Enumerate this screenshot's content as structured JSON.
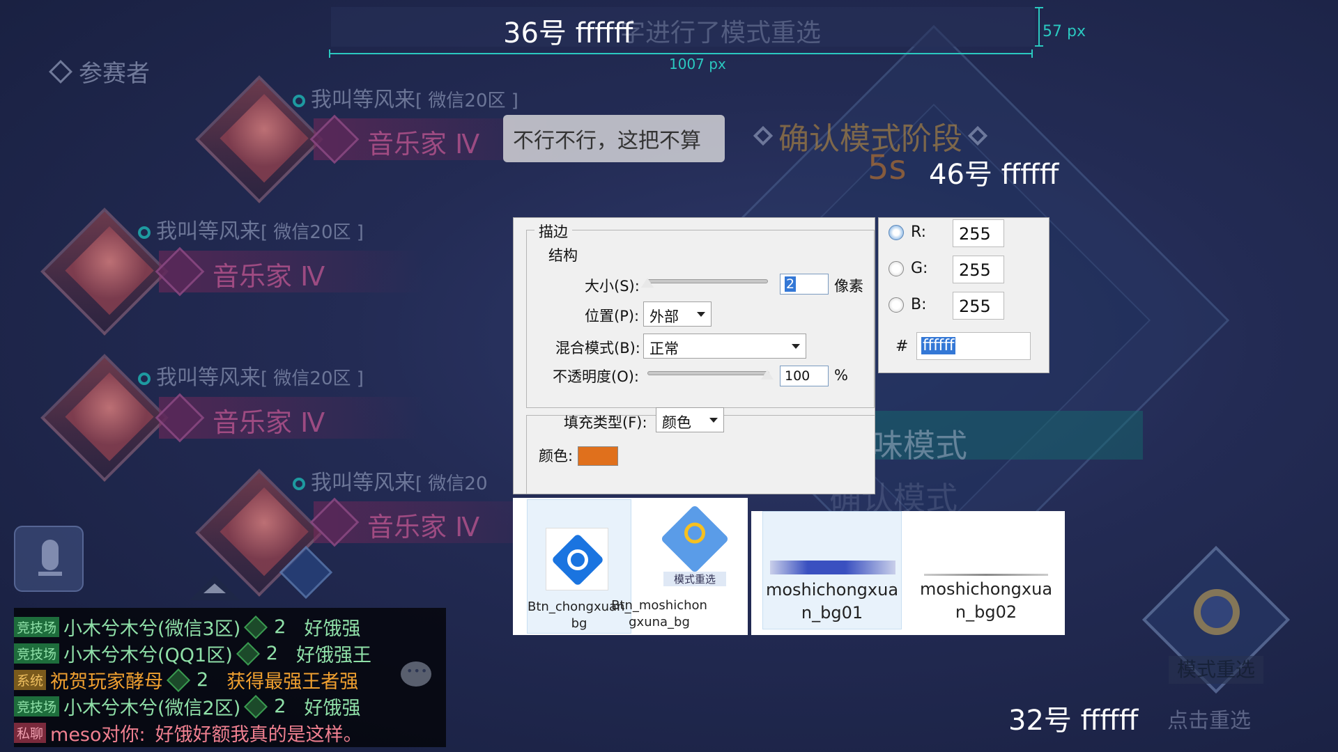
{
  "header": {
    "title_note": "36号 ffffff",
    "title_faded": "字进行了模式重选",
    "width_measure": "1007 px",
    "height_measure": "57 px"
  },
  "participants": {
    "heading": "参赛者",
    "players": [
      {
        "name": "我叫等风来",
        "server": "[ 微信20区 ]",
        "rank": "音乐家 Ⅳ"
      },
      {
        "name": "我叫等风来",
        "server": "[ 微信20区 ]",
        "rank": "音乐家 Ⅳ"
      },
      {
        "name": "我叫等风来",
        "server": "[ 微信20区 ]",
        "rank": "音乐家 Ⅳ"
      },
      {
        "name": "我叫等风来",
        "server": "[ 微信20",
        "rank": "音乐家 Ⅳ"
      }
    ],
    "chat_bubble": "不行不行，这把不算"
  },
  "confirm": {
    "title": "确认模式阶段",
    "timer": "5s",
    "note": "46号 ffffff",
    "bg_text_1": "味模式",
    "bg_text_2": "确认模式"
  },
  "stroke_panel": {
    "title": "描边",
    "structure": "结构",
    "size_label": "大小(S):",
    "size_value": "2",
    "size_unit": "像素",
    "position_label": "位置(P):",
    "position_value": "外部",
    "blend_label": "混合模式(B):",
    "blend_value": "正常",
    "opacity_label": "不透明度(O):",
    "opacity_value": "100",
    "opacity_unit": "%",
    "fill_label": "填充类型(F):",
    "fill_value": "颜色",
    "color_label": "颜色:",
    "color_hex": "#e0701c"
  },
  "rgb_panel": {
    "r_label": "R:",
    "r_value": "255",
    "g_label": "G:",
    "g_value": "255",
    "b_label": "B:",
    "b_value": "255",
    "hash": "#",
    "hex_value": "ffffff"
  },
  "assets": {
    "a1": {
      "line1": "Btn_chongxuan_",
      "line2": "bg"
    },
    "a2": {
      "line1": "Btn_moshichon",
      "line2": "gxuna_bg",
      "icon_label": "模式重选"
    },
    "a3": {
      "line1": "moshichongxua",
      "line2": "n_bg01"
    },
    "a4": {
      "line1": "moshichongxua",
      "line2": "n_bg02"
    }
  },
  "chat": {
    "lines": [
      {
        "tag": "竞技场",
        "name": "小木兮木兮(微信3区)",
        "lv": "2",
        "msg": "好饿强"
      },
      {
        "tag": "竞技场",
        "name": "小木兮木兮(QQ1区)",
        "lv": "2",
        "msg": "好饿强王"
      },
      {
        "tag": "系统",
        "name": "祝贺玩家酵母",
        "lv": "2",
        "msg": "获得最强王者强"
      },
      {
        "tag": "竞技场",
        "name": "小木兮木兮(微信2区)",
        "lv": "2",
        "msg": "好饿强"
      },
      {
        "tag": "私聊",
        "name": "meso对你:",
        "lv": "",
        "msg": "好饿好额我真的是这样。"
      }
    ]
  },
  "mode_button": {
    "label": "模式重选",
    "note": "32号 ffffff",
    "click_text": "点击重选"
  },
  "colors": {
    "accent_cyan": "#2bc9c0",
    "arena_tag": "#1e6d3c",
    "system_tag": "#7a5a1c",
    "private_tag": "#7a2a3c",
    "stroke_color": "#e0701c"
  }
}
